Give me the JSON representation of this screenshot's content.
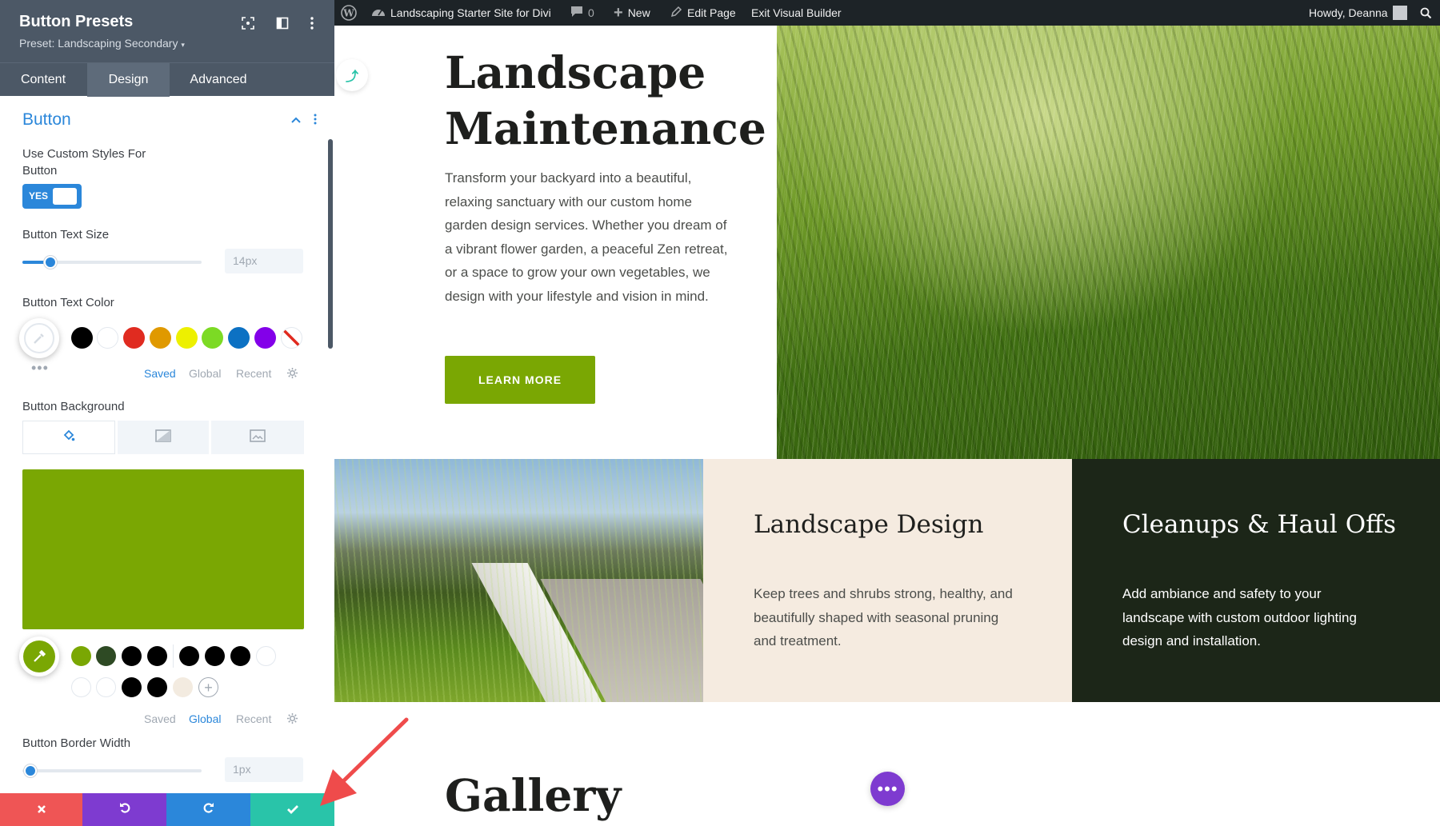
{
  "panel": {
    "title": "Button Presets",
    "preset_label": "Preset: Landscaping Secondary",
    "tabs": [
      {
        "label": "Content",
        "active": false
      },
      {
        "label": "Design",
        "active": true
      },
      {
        "label": "Advanced",
        "active": false
      }
    ],
    "section_title": "Button",
    "custom_styles": {
      "label_line1": "Use Custom Styles For",
      "label_line2": "Button",
      "toggle_text": "YES",
      "enabled": true
    },
    "text_size": {
      "label": "Button Text Size",
      "value": "14px"
    },
    "text_color": {
      "label": "Button Text Color",
      "swatches": [
        "#000000",
        "#ffffff",
        "#e02b20",
        "#e09900",
        "#edf000",
        "#7cda24",
        "#0c71c3",
        "#8300e9"
      ],
      "swatch_tabs": [
        {
          "label": "Saved",
          "active": true
        },
        {
          "label": "Global",
          "active": false
        },
        {
          "label": "Recent",
          "active": false
        }
      ]
    },
    "background": {
      "label": "Button Background",
      "color": "#7aa703",
      "swatches_row1": [
        "#7aa703",
        "#2e4a24",
        "#000000",
        "#000000",
        "#000000",
        "#000000",
        "#000000",
        "#ffffff"
      ],
      "swatches_row2": [
        "#ffffff",
        "#ffffff",
        "#000000",
        "#000000",
        "#f3ebe0"
      ],
      "swatch_tabs": [
        {
          "label": "Saved",
          "active": false
        },
        {
          "label": "Global",
          "active": true
        },
        {
          "label": "Recent",
          "active": false
        }
      ]
    },
    "border_width": {
      "label": "Button Border Width",
      "value": "1px"
    }
  },
  "adminbar": {
    "site_name": "Landscaping Starter Site for Divi",
    "comments_count": "0",
    "new_label": "New",
    "edit_page_label": "Edit Page",
    "exit_label": "Exit Visual Builder",
    "greeting": "Howdy, Deanna"
  },
  "page": {
    "hero_heading_line1": "Landscape",
    "hero_heading_line2": "Maintenance",
    "hero_text": "Transform your backyard into a beautiful, relaxing sanctuary with our custom home garden design services. Whether you dream of a vibrant flower garden, a peaceful Zen retreat, or a space to grow your own vegetables, we design with your lifestyle and vision in mind.",
    "hero_button": "LEARN MORE",
    "design_card": {
      "title": "Landscape Design",
      "text": "Keep trees and shrubs strong, healthy, and beautifully shaped with seasonal pruning and treatment."
    },
    "cleanup_card": {
      "title": "Cleanups & Haul Offs",
      "text": "Add ambiance and safety to your landscape with custom outdoor lighting design and installation."
    },
    "gallery_heading": "Gallery",
    "accent_color": "#7aa703"
  },
  "icons": [
    "focus-icon",
    "split-view-icon",
    "kebab-menu-icon",
    "chevron-up-icon",
    "eyedropper-icon",
    "gear-icon",
    "paint-bucket-icon",
    "gradient-icon",
    "image-icon",
    "plus-icon",
    "close-icon",
    "undo-icon",
    "redo-icon",
    "check-icon",
    "wordpress-icon",
    "dashboard-icon",
    "comment-icon",
    "pencil-icon",
    "search-icon",
    "more-dots-icon",
    "arrow-annotation"
  ]
}
